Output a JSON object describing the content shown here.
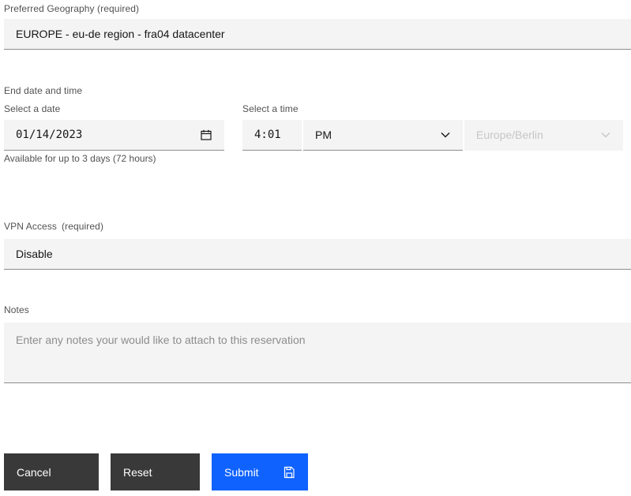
{
  "geography": {
    "label": "Preferred Geography (required)",
    "value": "EUROPE - eu-de region - fra04 datacenter"
  },
  "end_date_time": {
    "section_label": "End date and time",
    "date": {
      "label": "Select a date",
      "value": "01/14/2023",
      "icon": "calendar-icon",
      "helper": "Available for up to 3 days (72 hours)"
    },
    "time": {
      "label": "Select a time",
      "value": "4:01",
      "period": "PM",
      "timezone": "Europe/Berlin"
    }
  },
  "vpn": {
    "label": "VPN Access",
    "required": "(required)",
    "value": "Disable"
  },
  "notes": {
    "label": "Notes",
    "placeholder": "Enter any notes your would like to attach to this reservation"
  },
  "buttons": {
    "cancel": "Cancel",
    "reset": "Reset",
    "submit": "Submit",
    "submit_icon": "save-icon"
  },
  "colors": {
    "primary": "#0f62fe",
    "secondary": "#393939",
    "field_bg": "#f4f4f4"
  }
}
